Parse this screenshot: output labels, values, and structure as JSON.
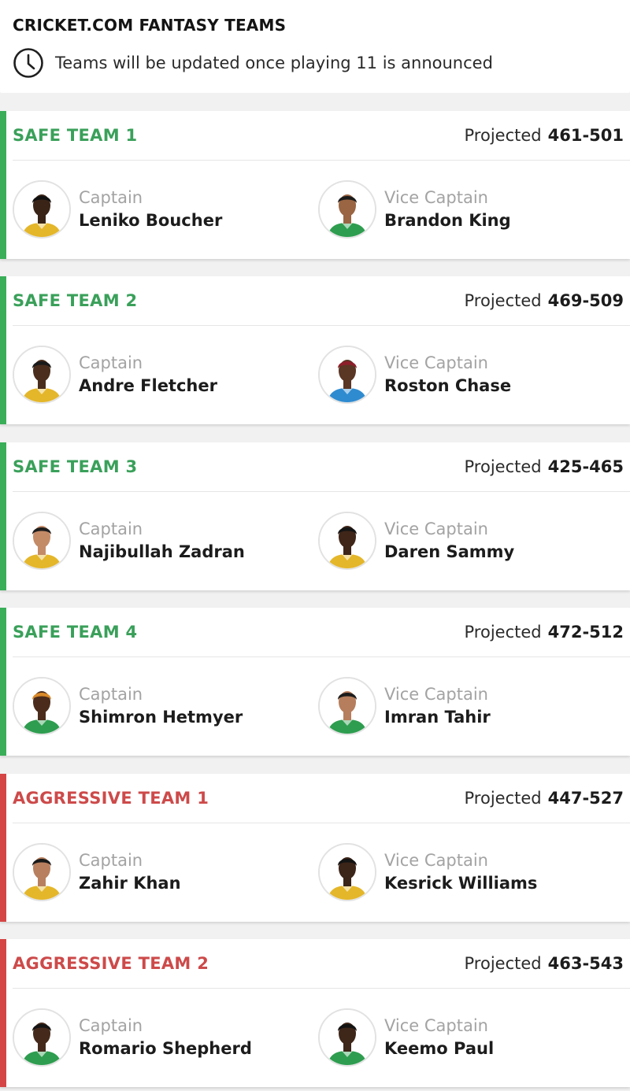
{
  "header": {
    "title": "CRICKET.COM FANTASY TEAMS",
    "note": "Teams will be updated once playing 11 is announced",
    "note_icon": "clock-icon"
  },
  "labels": {
    "projected": "Projected",
    "captain": "Captain",
    "vice_captain": "Vice Captain"
  },
  "colors": {
    "safe": "#3aae59",
    "aggressive": "#d54545"
  },
  "teams": [
    {
      "name": "SAFE TEAM 1",
      "kind": "safe",
      "projected": "461-501",
      "captain": {
        "name": "Leniko Boucher",
        "skin": "#3a2418",
        "hair": "#111",
        "jersey": "#e4b62a"
      },
      "vice_captain": {
        "name": "Brandon King",
        "skin": "#9a6543",
        "hair": "#1b1b1b",
        "jersey": "#2e9d4f"
      }
    },
    {
      "name": "SAFE TEAM 2",
      "kind": "safe",
      "projected": "469-509",
      "captain": {
        "name": "Andre Fletcher",
        "skin": "#4a2d1c",
        "hair": "#1a1a1a",
        "jersey": "#e4b62a"
      },
      "vice_captain": {
        "name": "Roston Chase",
        "skin": "#5a3624",
        "hair": "#8d1f2a",
        "jersey": "#2f8bd0"
      }
    },
    {
      "name": "SAFE TEAM 3",
      "kind": "safe",
      "projected": "425-465",
      "captain": {
        "name": "Najibullah Zadran",
        "skin": "#c48b67",
        "hair": "#1e1e1e",
        "jersey": "#e4b62a"
      },
      "vice_captain": {
        "name": "Daren Sammy",
        "skin": "#3f2619",
        "hair": "#151515",
        "jersey": "#e4b62a"
      }
    },
    {
      "name": "SAFE TEAM 4",
      "kind": "safe",
      "projected": "472-512",
      "captain": {
        "name": "Shimron Hetmyer",
        "skin": "#4b2c1c",
        "hair": "#d98a2a",
        "jersey": "#2e9d4f"
      },
      "vice_captain": {
        "name": "Imran Tahir",
        "skin": "#b67e5c",
        "hair": "#1c1c1c",
        "jersey": "#2e9d4f"
      }
    },
    {
      "name": "AGGRESSIVE TEAM 1",
      "kind": "aggr",
      "projected": "447-527",
      "captain": {
        "name": "Zahir Khan",
        "skin": "#b8805e",
        "hair": "#1a1a1a",
        "jersey": "#e4b62a"
      },
      "vice_captain": {
        "name": "Kesrick Williams",
        "skin": "#3b2418",
        "hair": "#141414",
        "jersey": "#e4b62a"
      }
    },
    {
      "name": "AGGRESSIVE TEAM 2",
      "kind": "aggr",
      "projected": "463-543",
      "captain": {
        "name": "Romario Shepherd",
        "skin": "#452a1b",
        "hair": "#151515",
        "jersey": "#2e9d4f"
      },
      "vice_captain": {
        "name": "Keemo Paul",
        "skin": "#3e2619",
        "hair": "#131313",
        "jersey": "#2e9d4f"
      }
    }
  ]
}
